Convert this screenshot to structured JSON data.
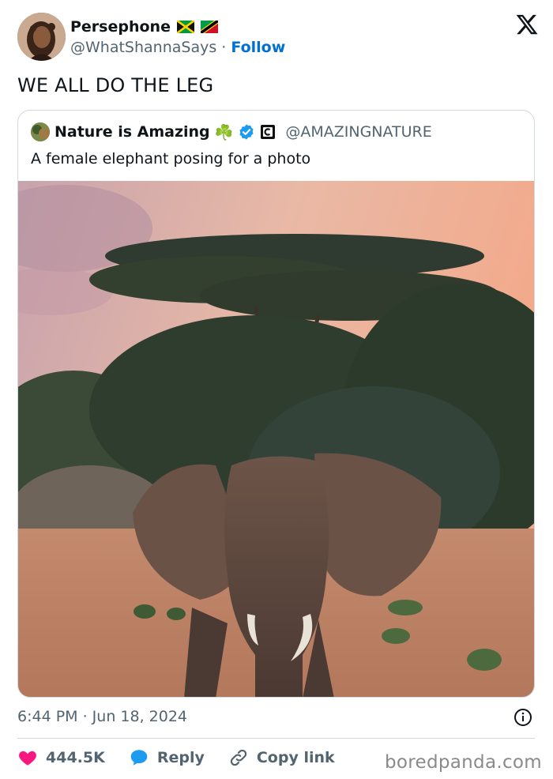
{
  "author": {
    "display_name": "Persephone",
    "handle": "@WhatShannaSays",
    "separator": "·",
    "follow_label": "Follow"
  },
  "tweet": {
    "text": "WE ALL DO THE LEG"
  },
  "quoted": {
    "display_name": "Nature is Amazing",
    "emoji": "☘️",
    "handle": "@AMAZINGNATURE",
    "text": "A female elephant posing for a photo"
  },
  "meta": {
    "timestamp": "6:44 PM · Jun 18, 2024"
  },
  "actions": {
    "likes": "444.5K",
    "reply_label": "Reply",
    "copy_link_label": "Copy link"
  },
  "watermark": "boredpanda.com",
  "colors": {
    "link_blue": "#006fd6",
    "like_red": "#f91880",
    "reply_blue": "#1d9bf0",
    "verified_blue": "#1d9bf0",
    "muted": "#536471"
  }
}
